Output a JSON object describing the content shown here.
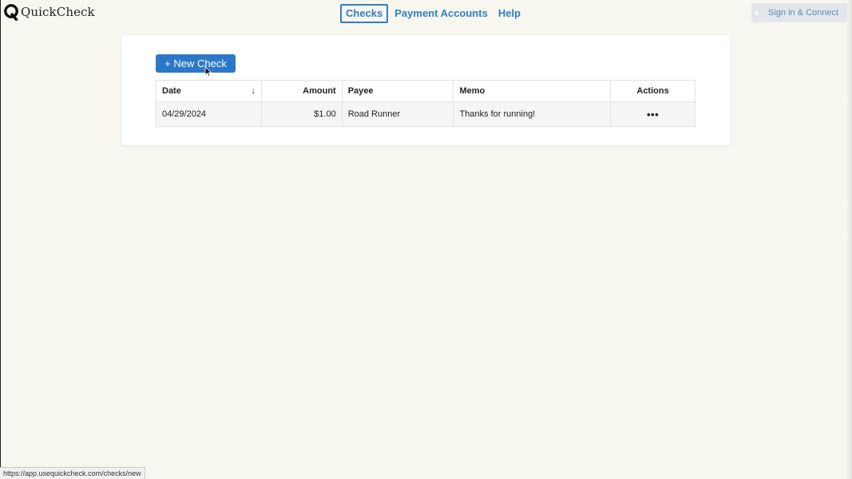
{
  "app": {
    "logo_text": "QuickCheck"
  },
  "nav": {
    "items": [
      {
        "label": "Checks",
        "active": true
      },
      {
        "label": "Payment Accounts",
        "active": false
      },
      {
        "label": "Help",
        "active": false
      }
    ]
  },
  "signin": {
    "label": "Sign in & Connect"
  },
  "toolbar": {
    "new_check_label": "+ New Check"
  },
  "table": {
    "columns": {
      "date": "Date",
      "amount": "Amount",
      "payee": "Payee",
      "memo": "Memo",
      "actions": "Actions"
    },
    "sort_indicator": "↓",
    "rows": [
      {
        "date": "04/29/2024",
        "amount": "$1.00",
        "payee": "Road Runner",
        "memo": "Thanks for running!",
        "actions": "•••"
      }
    ]
  },
  "status_bar": {
    "url": "https://app.usequickcheck.com/checks/new"
  },
  "colors": {
    "accent": "#2c78c8",
    "nav_link": "#2f7fc4",
    "background": "#f7f6ef"
  }
}
